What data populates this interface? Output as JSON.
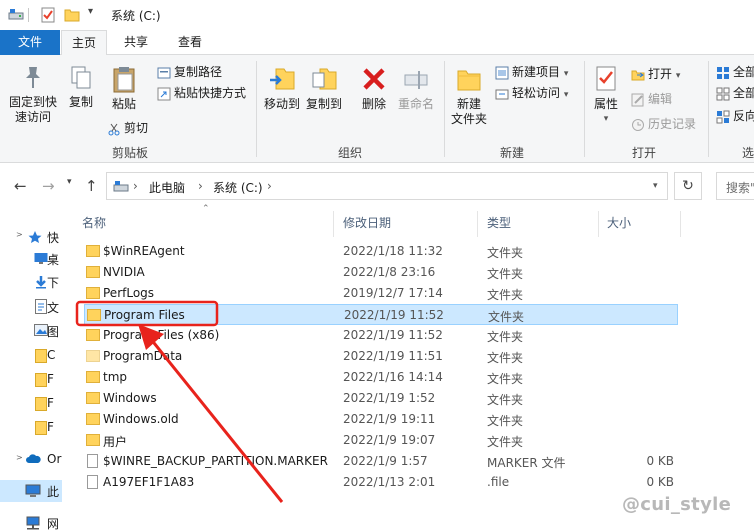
{
  "window": {
    "title": "系统 (C:)"
  },
  "tabs": [
    {
      "label": "文件"
    },
    {
      "label": "主页"
    },
    {
      "label": "共享"
    },
    {
      "label": "查看"
    }
  ],
  "ribbon": {
    "clipboard": {
      "group_label": "剪贴板",
      "pin_label_1": "固定到快",
      "pin_label_2": "速访问",
      "copy_label": "复制",
      "paste_label": "粘贴",
      "copy_path_label": "复制路径",
      "paste_shortcut_label": "粘贴快捷方式",
      "cut_label": "剪切"
    },
    "organize": {
      "group_label": "组织",
      "move_to_label": "移动到",
      "copy_to_label": "复制到",
      "delete_label": "删除",
      "rename_label": "重命名"
    },
    "new": {
      "group_label": "新建",
      "new_folder_label_1": "新建",
      "new_folder_label_2": "文件夹",
      "new_item_label": "新建项目",
      "easy_access_label": "轻松访问"
    },
    "open": {
      "group_label": "打开",
      "properties_label": "属性",
      "open_label": "打开",
      "edit_label": "编辑",
      "history_label": "历史记录"
    },
    "select": {
      "group_label": "选",
      "select_all_label": "全部",
      "select_none_label": "全部",
      "invert_label": "反向"
    }
  },
  "address": {
    "this_pc": "此电脑",
    "drive": "系统 (C:)",
    "search_placeholder": "搜索\""
  },
  "navpane": {
    "items": [
      {
        "label": "快"
      },
      {
        "label": "桌"
      },
      {
        "label": "下"
      },
      {
        "label": "文"
      },
      {
        "label": "图"
      },
      {
        "label": "C"
      },
      {
        "label": "F"
      },
      {
        "label": "F"
      },
      {
        "label": "F"
      },
      {
        "label": "Or"
      },
      {
        "label": "此"
      },
      {
        "label": "网"
      }
    ]
  },
  "columns": {
    "name": "名称",
    "date": "修改日期",
    "type": "类型",
    "size": "大小"
  },
  "files": [
    {
      "name": "$WinREAgent",
      "date": "2022/1/18 11:32",
      "type": "文件夹",
      "size": ""
    },
    {
      "name": "NVIDIA",
      "date": "2022/1/8 23:16",
      "type": "文件夹",
      "size": ""
    },
    {
      "name": "PerfLogs",
      "date": "2019/12/7 17:14",
      "type": "文件夹",
      "size": ""
    },
    {
      "name": "Program Files",
      "date": "2022/1/19 11:52",
      "type": "文件夹",
      "size": ""
    },
    {
      "name": "Program Files (x86)",
      "date": "2022/1/19 11:52",
      "type": "文件夹",
      "size": ""
    },
    {
      "name": "ProgramData",
      "date": "2022/1/19 11:51",
      "type": "文件夹",
      "size": ""
    },
    {
      "name": "tmp",
      "date": "2022/1/16 14:14",
      "type": "文件夹",
      "size": ""
    },
    {
      "name": "Windows",
      "date": "2022/1/19 1:52",
      "type": "文件夹",
      "size": ""
    },
    {
      "name": "Windows.old",
      "date": "2022/1/9 19:11",
      "type": "文件夹",
      "size": ""
    },
    {
      "name": "用户",
      "date": "2022/1/9 19:07",
      "type": "文件夹",
      "size": ""
    },
    {
      "name": "$WINRE_BACKUP_PARTITION.MARKER",
      "date": "2022/1/9 1:57",
      "type": "MARKER 文件",
      "size": "0 KB"
    },
    {
      "name": "A197EF1F1A83",
      "date": "2022/1/13 2:01",
      "type": ".file",
      "size": "0 KB"
    }
  ],
  "watermark": "@cui_style",
  "colors": {
    "accent": "#1a73c8",
    "selection": "#cce8ff",
    "selection_border": "#99d1ff",
    "folder": "#ffd35c",
    "annotation": "#e8231c"
  }
}
